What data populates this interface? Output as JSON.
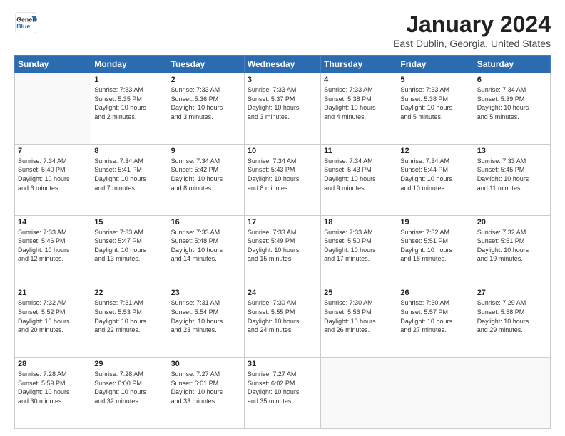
{
  "header": {
    "logo_general": "General",
    "logo_blue": "Blue",
    "title": "January 2024",
    "location": "East Dublin, Georgia, United States"
  },
  "days_of_week": [
    "Sunday",
    "Monday",
    "Tuesday",
    "Wednesday",
    "Thursday",
    "Friday",
    "Saturday"
  ],
  "weeks": [
    [
      {
        "day": "",
        "info": ""
      },
      {
        "day": "1",
        "info": "Sunrise: 7:33 AM\nSunset: 5:35 PM\nDaylight: 10 hours\nand 2 minutes."
      },
      {
        "day": "2",
        "info": "Sunrise: 7:33 AM\nSunset: 5:36 PM\nDaylight: 10 hours\nand 3 minutes."
      },
      {
        "day": "3",
        "info": "Sunrise: 7:33 AM\nSunset: 5:37 PM\nDaylight: 10 hours\nand 3 minutes."
      },
      {
        "day": "4",
        "info": "Sunrise: 7:33 AM\nSunset: 5:38 PM\nDaylight: 10 hours\nand 4 minutes."
      },
      {
        "day": "5",
        "info": "Sunrise: 7:33 AM\nSunset: 5:38 PM\nDaylight: 10 hours\nand 5 minutes."
      },
      {
        "day": "6",
        "info": "Sunrise: 7:34 AM\nSunset: 5:39 PM\nDaylight: 10 hours\nand 5 minutes."
      }
    ],
    [
      {
        "day": "7",
        "info": "Sunrise: 7:34 AM\nSunset: 5:40 PM\nDaylight: 10 hours\nand 6 minutes."
      },
      {
        "day": "8",
        "info": "Sunrise: 7:34 AM\nSunset: 5:41 PM\nDaylight: 10 hours\nand 7 minutes."
      },
      {
        "day": "9",
        "info": "Sunrise: 7:34 AM\nSunset: 5:42 PM\nDaylight: 10 hours\nand 8 minutes."
      },
      {
        "day": "10",
        "info": "Sunrise: 7:34 AM\nSunset: 5:43 PM\nDaylight: 10 hours\nand 8 minutes."
      },
      {
        "day": "11",
        "info": "Sunrise: 7:34 AM\nSunset: 5:43 PM\nDaylight: 10 hours\nand 9 minutes."
      },
      {
        "day": "12",
        "info": "Sunrise: 7:34 AM\nSunset: 5:44 PM\nDaylight: 10 hours\nand 10 minutes."
      },
      {
        "day": "13",
        "info": "Sunrise: 7:33 AM\nSunset: 5:45 PM\nDaylight: 10 hours\nand 11 minutes."
      }
    ],
    [
      {
        "day": "14",
        "info": "Sunrise: 7:33 AM\nSunset: 5:46 PM\nDaylight: 10 hours\nand 12 minutes."
      },
      {
        "day": "15",
        "info": "Sunrise: 7:33 AM\nSunset: 5:47 PM\nDaylight: 10 hours\nand 13 minutes."
      },
      {
        "day": "16",
        "info": "Sunrise: 7:33 AM\nSunset: 5:48 PM\nDaylight: 10 hours\nand 14 minutes."
      },
      {
        "day": "17",
        "info": "Sunrise: 7:33 AM\nSunset: 5:49 PM\nDaylight: 10 hours\nand 15 minutes."
      },
      {
        "day": "18",
        "info": "Sunrise: 7:33 AM\nSunset: 5:50 PM\nDaylight: 10 hours\nand 17 minutes."
      },
      {
        "day": "19",
        "info": "Sunrise: 7:32 AM\nSunset: 5:51 PM\nDaylight: 10 hours\nand 18 minutes."
      },
      {
        "day": "20",
        "info": "Sunrise: 7:32 AM\nSunset: 5:51 PM\nDaylight: 10 hours\nand 19 minutes."
      }
    ],
    [
      {
        "day": "21",
        "info": "Sunrise: 7:32 AM\nSunset: 5:52 PM\nDaylight: 10 hours\nand 20 minutes."
      },
      {
        "day": "22",
        "info": "Sunrise: 7:31 AM\nSunset: 5:53 PM\nDaylight: 10 hours\nand 22 minutes."
      },
      {
        "day": "23",
        "info": "Sunrise: 7:31 AM\nSunset: 5:54 PM\nDaylight: 10 hours\nand 23 minutes."
      },
      {
        "day": "24",
        "info": "Sunrise: 7:30 AM\nSunset: 5:55 PM\nDaylight: 10 hours\nand 24 minutes."
      },
      {
        "day": "25",
        "info": "Sunrise: 7:30 AM\nSunset: 5:56 PM\nDaylight: 10 hours\nand 26 minutes."
      },
      {
        "day": "26",
        "info": "Sunrise: 7:30 AM\nSunset: 5:57 PM\nDaylight: 10 hours\nand 27 minutes."
      },
      {
        "day": "27",
        "info": "Sunrise: 7:29 AM\nSunset: 5:58 PM\nDaylight: 10 hours\nand 29 minutes."
      }
    ],
    [
      {
        "day": "28",
        "info": "Sunrise: 7:28 AM\nSunset: 5:59 PM\nDaylight: 10 hours\nand 30 minutes."
      },
      {
        "day": "29",
        "info": "Sunrise: 7:28 AM\nSunset: 6:00 PM\nDaylight: 10 hours\nand 32 minutes."
      },
      {
        "day": "30",
        "info": "Sunrise: 7:27 AM\nSunset: 6:01 PM\nDaylight: 10 hours\nand 33 minutes."
      },
      {
        "day": "31",
        "info": "Sunrise: 7:27 AM\nSunset: 6:02 PM\nDaylight: 10 hours\nand 35 minutes."
      },
      {
        "day": "",
        "info": ""
      },
      {
        "day": "",
        "info": ""
      },
      {
        "day": "",
        "info": ""
      }
    ]
  ]
}
